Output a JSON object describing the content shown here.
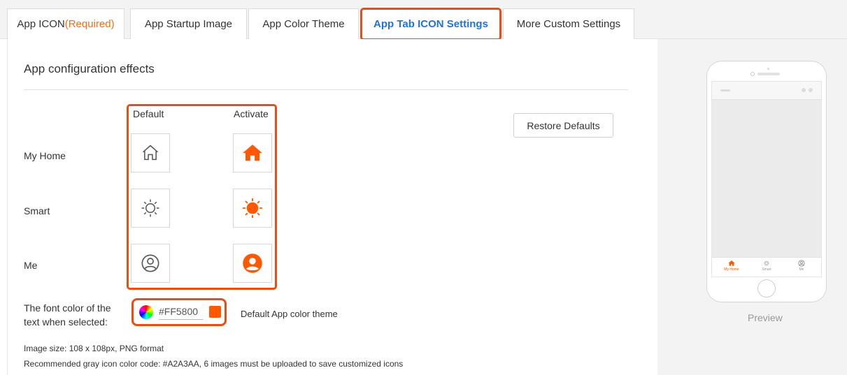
{
  "tabs": [
    {
      "label": "App ICON",
      "suffix": "(Required)"
    },
    {
      "label": "App Startup Image"
    },
    {
      "label": "App Color Theme"
    },
    {
      "label": "App Tab ICON Settings"
    },
    {
      "label": "More Custom Settings"
    }
  ],
  "active_tab_index": 3,
  "section_title": "App configuration effects",
  "columns": {
    "default": "Default",
    "activate": "Activate"
  },
  "rows": [
    {
      "label": "My Home",
      "icon": "house-icon"
    },
    {
      "label": "Smart",
      "icon": "sun-icon"
    },
    {
      "label": "Me",
      "icon": "user-circle-icon"
    }
  ],
  "restore_button": "Restore Defaults",
  "font_color": {
    "label_line1": "The font color of the",
    "label_line2": "text when selected:",
    "hex_value": "#FF5800",
    "theme_text": "Default App color theme"
  },
  "notes": {
    "size": "Image size: 108 x 108px, PNG format",
    "recommend": "Recommended gray icon color code: #A2A3AA, 6 images must be uploaded to save customized icons"
  },
  "preview": {
    "label": "Preview",
    "tabs": [
      "My Home",
      "Smart",
      "Me"
    ]
  },
  "colors": {
    "accent": "#FF5800",
    "highlight_frame": "#EE4A12",
    "active_tab_text": "#1F74D4",
    "default_icon": "#555555"
  }
}
